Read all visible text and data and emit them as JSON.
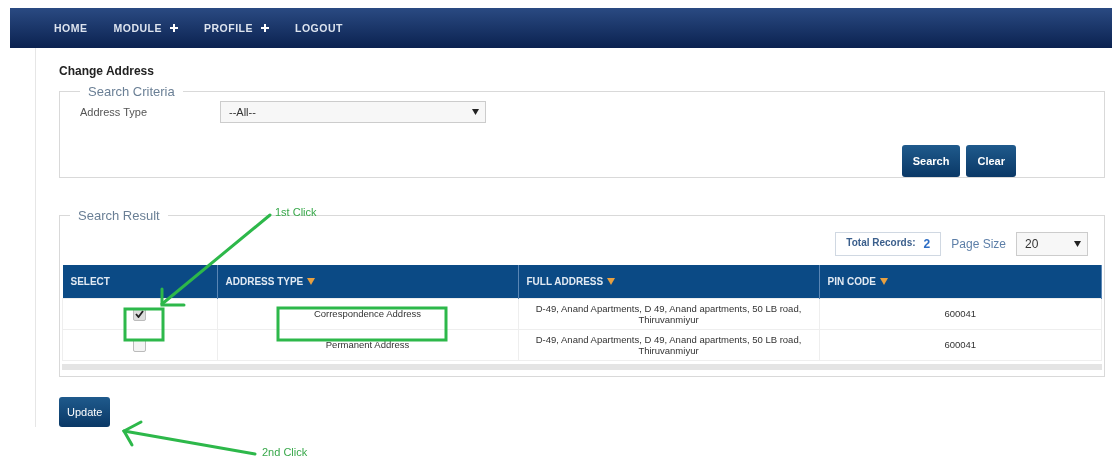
{
  "nav": [
    {
      "label": "HOME",
      "has_submenu": false
    },
    {
      "label": "MODULE",
      "has_submenu": true
    },
    {
      "label": "PROFILE",
      "has_submenu": true
    },
    {
      "label": "LOGOUT",
      "has_submenu": false
    }
  ],
  "page_title": "Change Address",
  "search_criteria": {
    "legend": "Search Criteria",
    "field_label": "Address Type",
    "value": "--All--",
    "buttons": [
      "Search",
      "Clear"
    ]
  },
  "search_result": {
    "legend": "Search Result",
    "total_label": "Total Records:",
    "total": "2",
    "page_size_label": "Page Size",
    "page_size": "20",
    "columns": [
      "SELECT",
      "ADDRESS TYPE",
      "FULL ADDRESS",
      "PIN CODE"
    ],
    "rows": [
      {
        "checked": true,
        "address_type": "Correspondence Address",
        "full_address": "D-49, Anand Apartments, D 49, Anand apartments, 50 LB road, Thiruvanmiyur",
        "pin_code": "600041"
      },
      {
        "checked": false,
        "address_type": "Permanent Address",
        "full_address": "D-49, Anand Apartments, D 49, Anand apartments, 50 LB road, Thiruvanmiyur",
        "pin_code": "600041"
      }
    ]
  },
  "update_button": "Update",
  "annotations": [
    {
      "text": "1st Click"
    },
    {
      "text": "2nd Click"
    }
  ]
}
